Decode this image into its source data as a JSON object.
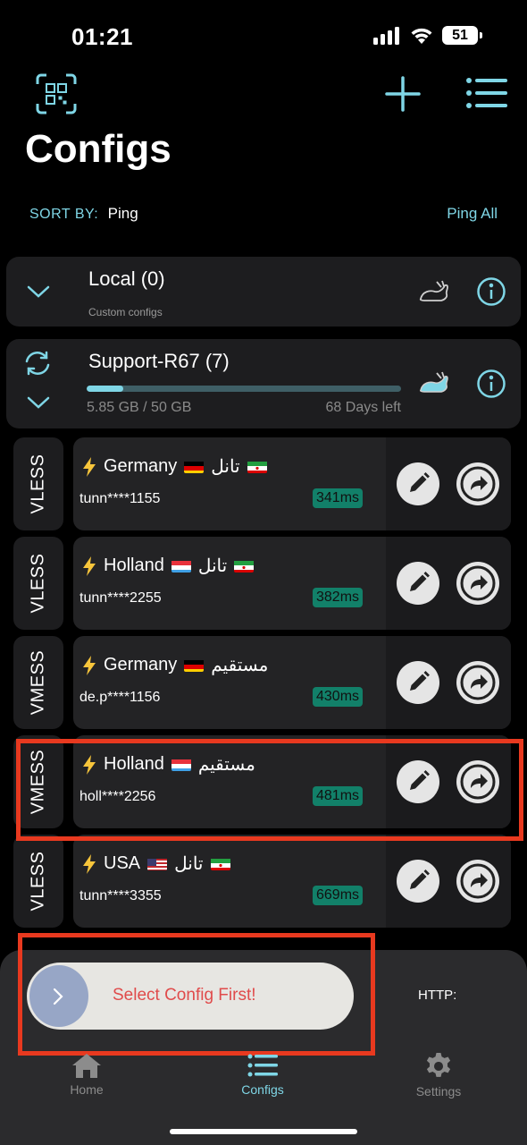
{
  "status_bar": {
    "time": "01:21",
    "battery": "51"
  },
  "header": {
    "title": "Configs"
  },
  "sort": {
    "label": "SORT BY:",
    "value": "Ping",
    "ping_all": "Ping All"
  },
  "groups": [
    {
      "title": "Local (0)",
      "subtitle": "Custom configs"
    },
    {
      "title": "Support-R67 (7)",
      "usage": "5.85 GB / 50 GB",
      "days_left": "68 Days left",
      "usage_fraction": 0.117
    }
  ],
  "configs": [
    {
      "protocol": "VLESS",
      "country": "Germany",
      "type": "تانل",
      "address": "tunn****1155",
      "ping": "341ms",
      "flag": "de",
      "flag2": "ir"
    },
    {
      "protocol": "VLESS",
      "country": "Holland",
      "type": "تانل",
      "address": "tunn****2255",
      "ping": "382ms",
      "flag": "nl",
      "flag2": "ir"
    },
    {
      "protocol": "VMESS",
      "country": "Germany",
      "type": "مستقیم",
      "address": "de.p****1156",
      "ping": "430ms",
      "flag": "de"
    },
    {
      "protocol": "VMESS",
      "country": "Holland",
      "type": "مستقیم",
      "address": "holl****2256",
      "ping": "481ms",
      "flag": "nl"
    },
    {
      "protocol": "VLESS",
      "country": "USA",
      "type": "تانل",
      "address": "tunn****3355",
      "ping": "669ms",
      "flag": "us",
      "flag2": "ir"
    }
  ],
  "bottom": {
    "slider_text": "Select Config First!",
    "http_label": "HTTP:"
  },
  "tabs": {
    "home": "Home",
    "configs": "Configs",
    "settings": "Settings"
  },
  "colors": {
    "accent": "#7fd6e6",
    "ping_bg": "#128069",
    "alert_red": "#e8391f"
  }
}
